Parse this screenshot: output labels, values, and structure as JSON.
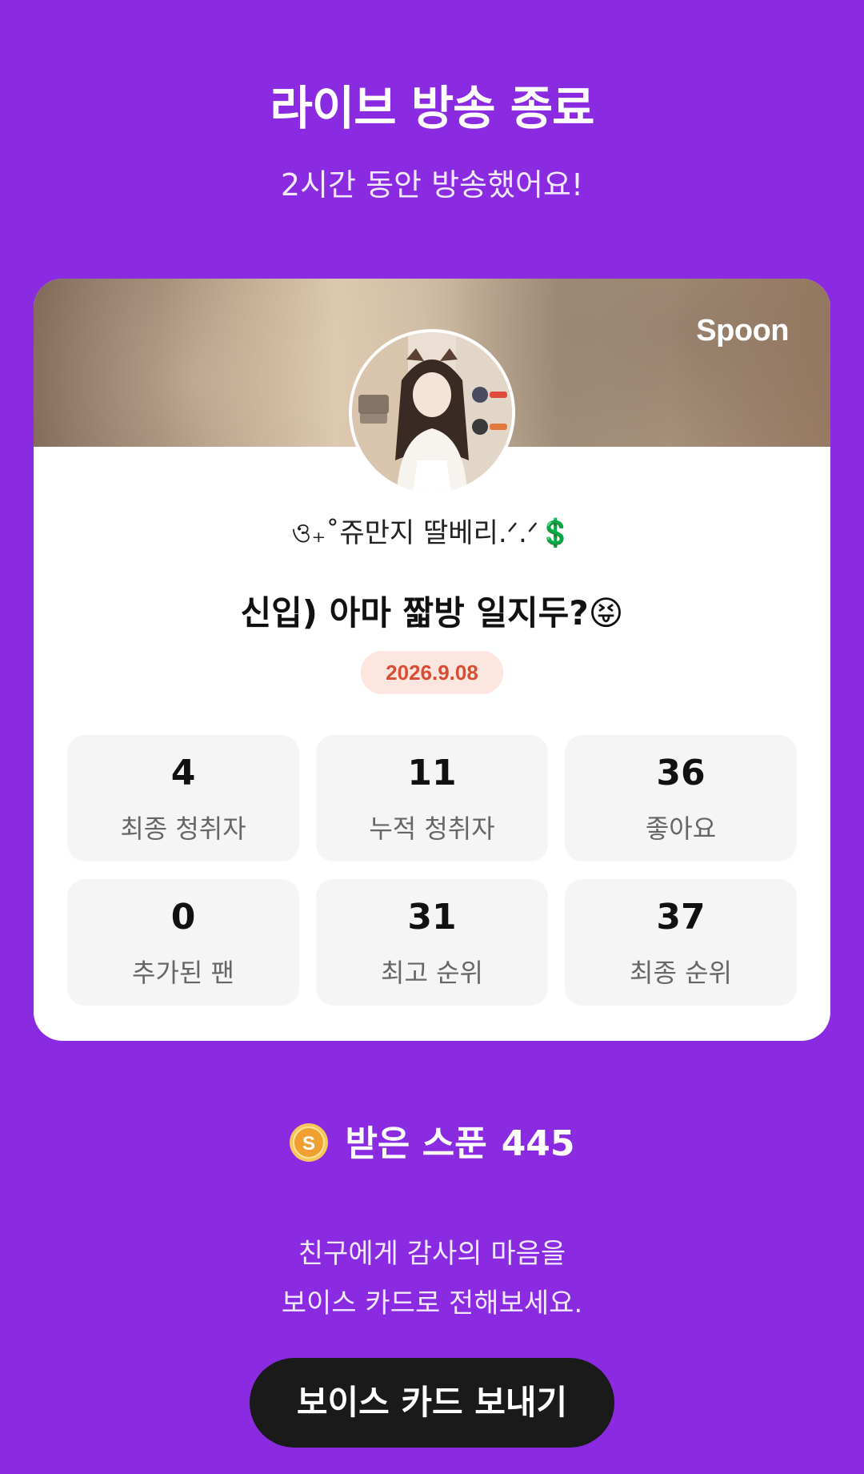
{
  "header": {
    "title": "라이브 방송 종료",
    "subtitle": "2시간 동안 방송했어요!"
  },
  "card": {
    "brand": "Spoon",
    "avatar_icon": "host-profile-photo",
    "nickname": "ও₊˚쥬만지 딸베리.ᐟ.ᐟ💲",
    "broadcast_title": "신입) 아마 짧방 일지두?😝",
    "date": "2026.9.08",
    "stats": [
      {
        "value": "4",
        "label": "최종 청취자"
      },
      {
        "value": "11",
        "label": "누적 청취자"
      },
      {
        "value": "36",
        "label": "좋아요"
      },
      {
        "value": "0",
        "label": "추가된 팬"
      },
      {
        "value": "31",
        "label": "최고 순위"
      },
      {
        "value": "37",
        "label": "최종 순위"
      }
    ]
  },
  "spoons": {
    "icon": "spoon-coin-icon",
    "label": "받은 스푼",
    "amount": "445"
  },
  "thanks": {
    "line1": "친구에게 감사의 마음을",
    "line2": "보이스 카드로 전해보세요."
  },
  "button": {
    "label": "보이스 카드 보내기"
  },
  "colors": {
    "background": "#8a2be2",
    "date_badge_bg": "#fde6e0",
    "date_badge_text": "#d94e32",
    "button_bg": "#1a1a1a",
    "coin": "#f0a030"
  }
}
